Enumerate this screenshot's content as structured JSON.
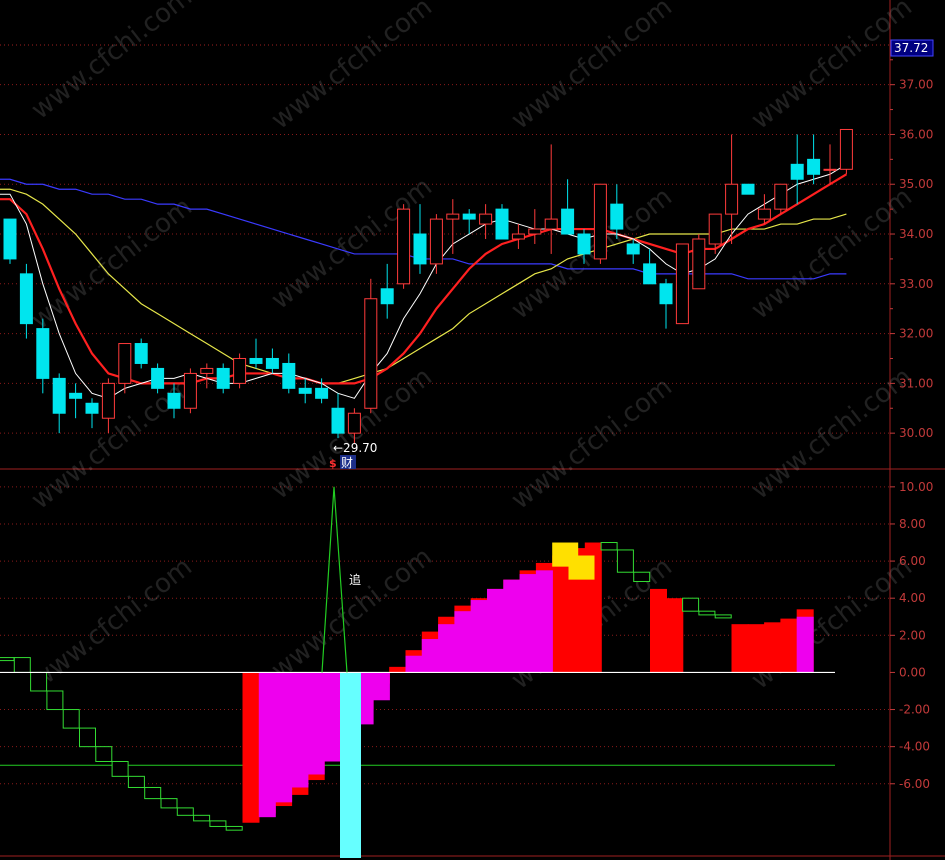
{
  "chart_data": [
    {
      "type": "candlestick",
      "panel": "price",
      "ylim": [
        29.3,
        38.5
      ],
      "yticks": [
        "30.00",
        "31.00",
        "32.00",
        "33.00",
        "34.00",
        "35.00",
        "36.00",
        "37.00"
      ],
      "current_price_label": "37.72",
      "low_marker_label": "←29.70",
      "event_marker_icon": "dollar-icon",
      "event_marker_label": "财",
      "colors": {
        "up": "#ff3b3b",
        "down": "#00e5ee",
        "ma5": "#ffffff",
        "ma10": "#ff2020",
        "ma20": "#e6e64a",
        "ma60": "#3a3aff"
      },
      "candles": [
        [
          34.3,
          34.3,
          33.4,
          33.5
        ],
        [
          33.2,
          33.4,
          31.9,
          32.2
        ],
        [
          32.1,
          32.3,
          30.8,
          31.1
        ],
        [
          31.1,
          31.2,
          30.0,
          30.4
        ],
        [
          30.8,
          31.0,
          30.3,
          30.7
        ],
        [
          30.6,
          30.7,
          30.1,
          30.4
        ],
        [
          30.3,
          31.1,
          30.0,
          31.0
        ],
        [
          31.0,
          31.8,
          30.8,
          31.8
        ],
        [
          31.8,
          31.9,
          31.3,
          31.4
        ],
        [
          31.3,
          31.4,
          30.8,
          30.9
        ],
        [
          30.8,
          31.0,
          30.3,
          30.5
        ],
        [
          30.5,
          31.3,
          30.4,
          31.2
        ],
        [
          31.2,
          31.4,
          30.9,
          31.3
        ],
        [
          31.3,
          31.4,
          30.8,
          30.9
        ],
        [
          31.0,
          31.6,
          30.9,
          31.5
        ],
        [
          31.5,
          31.9,
          31.3,
          31.4
        ],
        [
          31.5,
          31.7,
          31.2,
          31.3
        ],
        [
          31.4,
          31.6,
          30.8,
          30.9
        ],
        [
          30.9,
          31.1,
          30.6,
          30.8
        ],
        [
          30.9,
          31.1,
          30.6,
          30.7
        ],
        [
          30.5,
          30.8,
          29.9,
          30.0
        ],
        [
          30.0,
          30.5,
          29.8,
          30.4
        ],
        [
          30.5,
          33.1,
          30.4,
          32.7
        ],
        [
          32.9,
          33.4,
          32.3,
          32.6
        ],
        [
          33.0,
          34.6,
          32.9,
          34.5
        ],
        [
          34.0,
          34.6,
          33.2,
          33.4
        ],
        [
          33.4,
          34.4,
          33.2,
          34.3
        ],
        [
          34.3,
          34.7,
          33.6,
          34.4
        ],
        [
          34.4,
          34.5,
          34.0,
          34.3
        ],
        [
          34.2,
          34.6,
          33.9,
          34.4
        ],
        [
          34.5,
          34.6,
          33.9,
          33.9
        ],
        [
          33.9,
          34.2,
          33.7,
          34.0
        ],
        [
          34.0,
          34.5,
          33.8,
          34.1
        ],
        [
          34.1,
          35.8,
          33.6,
          34.3
        ],
        [
          34.5,
          35.1,
          34.0,
          34.0
        ],
        [
          34.0,
          34.1,
          33.4,
          33.6
        ],
        [
          33.5,
          35.0,
          33.4,
          35.0
        ],
        [
          34.6,
          35.0,
          33.9,
          34.1
        ],
        [
          33.8,
          33.9,
          33.4,
          33.6
        ],
        [
          33.4,
          33.7,
          33.0,
          33.0
        ],
        [
          33.0,
          33.1,
          32.1,
          32.6
        ],
        [
          32.2,
          33.8,
          32.2,
          33.8
        ],
        [
          32.9,
          34.0,
          32.9,
          33.9
        ],
        [
          33.8,
          34.4,
          33.6,
          34.4
        ],
        [
          34.4,
          36.0,
          33.8,
          35.0
        ],
        [
          35.0,
          35.0,
          34.8,
          34.8
        ],
        [
          34.3,
          34.8,
          34.2,
          34.5
        ],
        [
          34.5,
          35.0,
          34.4,
          35.0
        ],
        [
          35.4,
          36.0,
          34.6,
          35.1
        ],
        [
          35.5,
          36.0,
          35.0,
          35.2
        ],
        [
          35.3,
          35.8,
          35.0,
          35.3
        ],
        [
          35.3,
          36.1,
          35.2,
          36.1
        ]
      ],
      "ma5": [
        34.8,
        34.2,
        33.0,
        32.0,
        31.2,
        30.8,
        30.7,
        30.9,
        31.0,
        31.1,
        31.1,
        31.2,
        31.1,
        31.0,
        31.0,
        31.1,
        31.2,
        31.2,
        31.1,
        31.0,
        30.8,
        30.7,
        31.2,
        31.6,
        32.3,
        32.8,
        33.4,
        33.8,
        34.0,
        34.2,
        34.3,
        34.2,
        34.1,
        34.1,
        34.0,
        33.9,
        34.0,
        34.0,
        33.9,
        33.7,
        33.4,
        33.2,
        33.3,
        33.5,
        34.0,
        34.4,
        34.6,
        34.8,
        35.0,
        35.1,
        35.2,
        35.4
      ],
      "ma10": [
        34.7,
        34.4,
        33.7,
        32.9,
        32.2,
        31.6,
        31.2,
        31.1,
        31.0,
        31.0,
        31.0,
        31.0,
        31.1,
        31.1,
        31.2,
        31.2,
        31.2,
        31.1,
        31.1,
        31.0,
        31.0,
        31.0,
        31.1,
        31.3,
        31.6,
        32.0,
        32.5,
        32.9,
        33.3,
        33.6,
        33.8,
        33.9,
        34.0,
        34.1,
        34.1,
        34.1,
        34.1,
        34.0,
        33.9,
        33.8,
        33.7,
        33.6,
        33.7,
        33.7,
        33.9,
        34.1,
        34.2,
        34.4,
        34.6,
        34.8,
        35.0,
        35.2
      ],
      "ma20": [
        34.9,
        34.8,
        34.6,
        34.3,
        34.0,
        33.6,
        33.2,
        32.9,
        32.6,
        32.4,
        32.2,
        32.0,
        31.8,
        31.6,
        31.4,
        31.3,
        31.2,
        31.1,
        31.1,
        31.0,
        31.0,
        31.1,
        31.2,
        31.3,
        31.5,
        31.7,
        31.9,
        32.1,
        32.4,
        32.6,
        32.8,
        33.0,
        33.2,
        33.3,
        33.5,
        33.6,
        33.7,
        33.8,
        33.9,
        34.0,
        34.0,
        34.0,
        34.0,
        34.0,
        34.1,
        34.1,
        34.1,
        34.2,
        34.2,
        34.3,
        34.3,
        34.4
      ],
      "ma60": [
        35.1,
        35.0,
        35.0,
        34.9,
        34.9,
        34.8,
        34.8,
        34.7,
        34.7,
        34.6,
        34.6,
        34.5,
        34.5,
        34.4,
        34.3,
        34.2,
        34.1,
        34.0,
        33.9,
        33.8,
        33.7,
        33.6,
        33.6,
        33.6,
        33.6,
        33.5,
        33.5,
        33.5,
        33.4,
        33.4,
        33.4,
        33.4,
        33.4,
        33.4,
        33.3,
        33.3,
        33.3,
        33.3,
        33.3,
        33.2,
        33.2,
        33.2,
        33.2,
        33.2,
        33.2,
        33.1,
        33.1,
        33.1,
        33.1,
        33.1,
        33.2,
        33.2
      ]
    },
    {
      "type": "bar",
      "panel": "indicator",
      "ylim": [
        -10.0,
        10.8
      ],
      "yticks": [
        "10.00",
        "8.00",
        "6.00",
        "4.00",
        "2.00",
        "0.00",
        "-2.00",
        "-4.00",
        "-6.00"
      ],
      "signal_label": "追",
      "reference_line": -5.0,
      "colors": {
        "red": "#ff0000",
        "magenta": "#ee00ee",
        "yellow": "#ffe000",
        "cyan": "#66ffff",
        "hollow_green": "#33dd33",
        "signal_line": "#22cc22"
      },
      "red_values": [
        0.8,
        0.0,
        -1.0,
        -2.0,
        -3.0,
        -4.0,
        -4.8,
        -5.6,
        -6.2,
        -6.8,
        -7.3,
        -7.7,
        -8.0,
        -8.3,
        -8.5,
        -8.1,
        -7.6,
        -7.2,
        -6.6,
        -5.8,
        -4.8,
        -3.5,
        -2.0,
        -0.6,
        0.3,
        1.2,
        2.2,
        3.0,
        3.6,
        4.0,
        4.5,
        5.0,
        5.5,
        5.9,
        6.3,
        6.7,
        7.0,
        6.6,
        5.4,
        4.9,
        4.5,
        4.0,
        3.3,
        3.1,
        3.0,
        2.6,
        2.6,
        2.7,
        2.9,
        3.4
      ],
      "magenta_values": [
        null,
        null,
        null,
        null,
        null,
        null,
        null,
        null,
        null,
        null,
        null,
        null,
        null,
        null,
        null,
        null,
        -7.8,
        -7.0,
        -6.2,
        -5.5,
        -4.8,
        -4.0,
        -2.8,
        -1.5,
        0.0,
        0.9,
        1.8,
        2.6,
        3.3,
        3.9,
        4.5,
        5.0,
        5.3,
        5.5,
        null,
        null,
        null,
        null,
        null,
        null,
        null,
        null,
        null,
        null,
        null,
        null,
        null,
        null,
        null,
        3.0
      ],
      "yellow_values": [
        null,
        null,
        null,
        null,
        null,
        null,
        null,
        null,
        null,
        null,
        null,
        null,
        null,
        null,
        null,
        null,
        null,
        null,
        null,
        null,
        null,
        null,
        null,
        null,
        null,
        null,
        null,
        null,
        null,
        null,
        null,
        null,
        null,
        null,
        7.0,
        6.3,
        null,
        null,
        null,
        null,
        null,
        null,
        null,
        null,
        null,
        null,
        null,
        null,
        null,
        null
      ],
      "cyan_bar": {
        "top": 0.0,
        "bottom": -10.0
      },
      "signal_peak": 10.0
    }
  ]
}
